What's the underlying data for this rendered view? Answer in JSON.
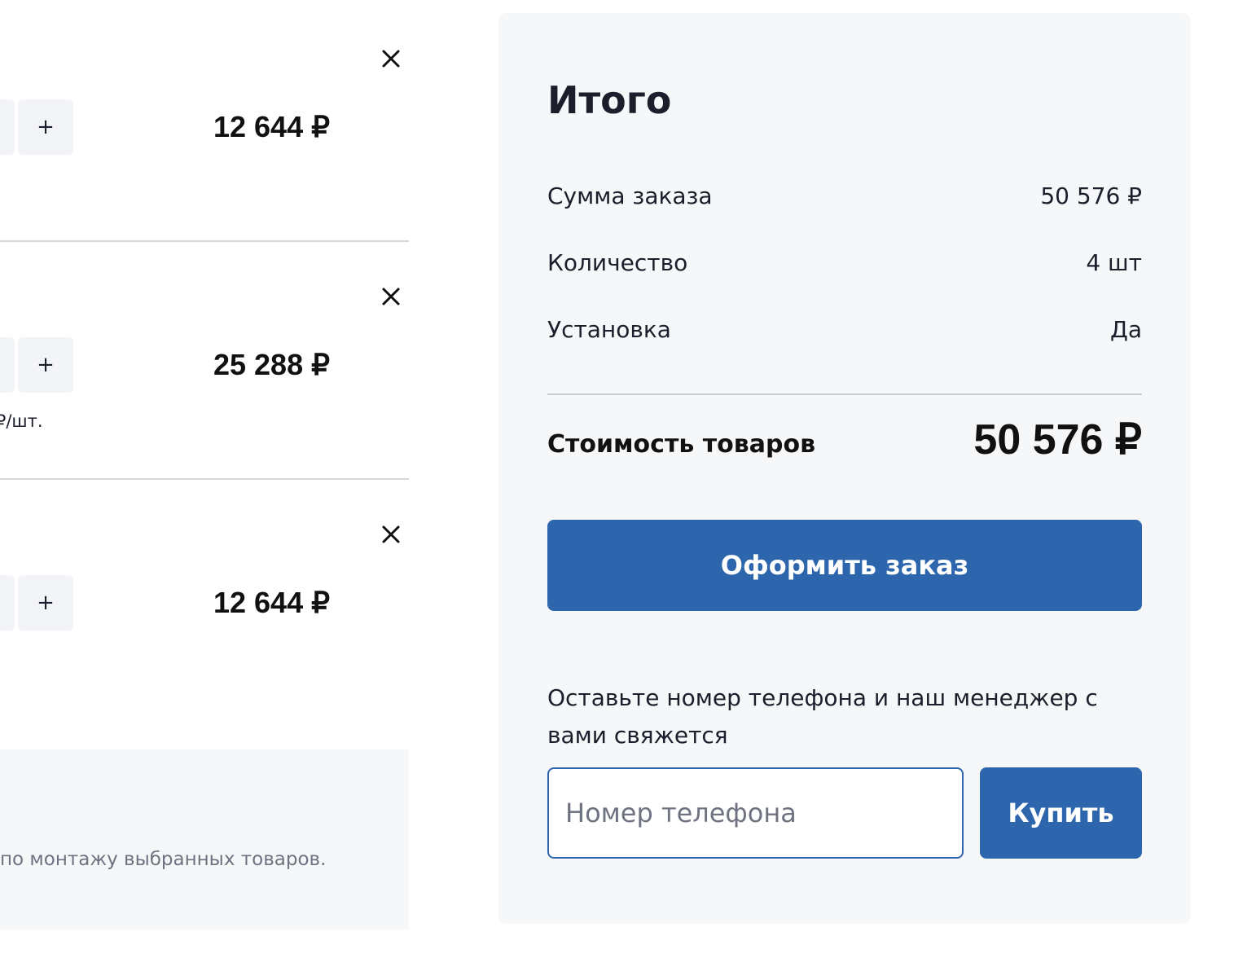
{
  "cart": {
    "items": [
      {
        "price": "12 644 ₽",
        "plus_label": "+",
        "unit_price": ""
      },
      {
        "price": "25 288 ₽",
        "plus_label": "+",
        "unit_price": "₽/шт."
      },
      {
        "price": "12 644 ₽",
        "plus_label": "+",
        "unit_price": ""
      }
    ],
    "install_note": "по монтажу выбранных товаров."
  },
  "icons": {
    "remove": "close-icon"
  },
  "summary": {
    "title": "Итого",
    "rows": [
      {
        "label": "Сумма заказа",
        "value": "50 576 ₽"
      },
      {
        "label": "Количество",
        "value": "4 шт"
      },
      {
        "label": "Установка",
        "value": "Да"
      }
    ],
    "total_label": "Стоимость товаров",
    "total_value": "50 576 ₽",
    "checkout_label": "Оформить заказ",
    "callback_text": "Оставьте номер телефона и наш менеджер с вами свяжется",
    "phone_placeholder": "Номер телефона",
    "buy_label": "Купить"
  },
  "colors": {
    "accent": "#2d66ad",
    "panel_bg": "#f6f7f9",
    "text": "#1b1f2b",
    "muted": "#6f7280"
  }
}
